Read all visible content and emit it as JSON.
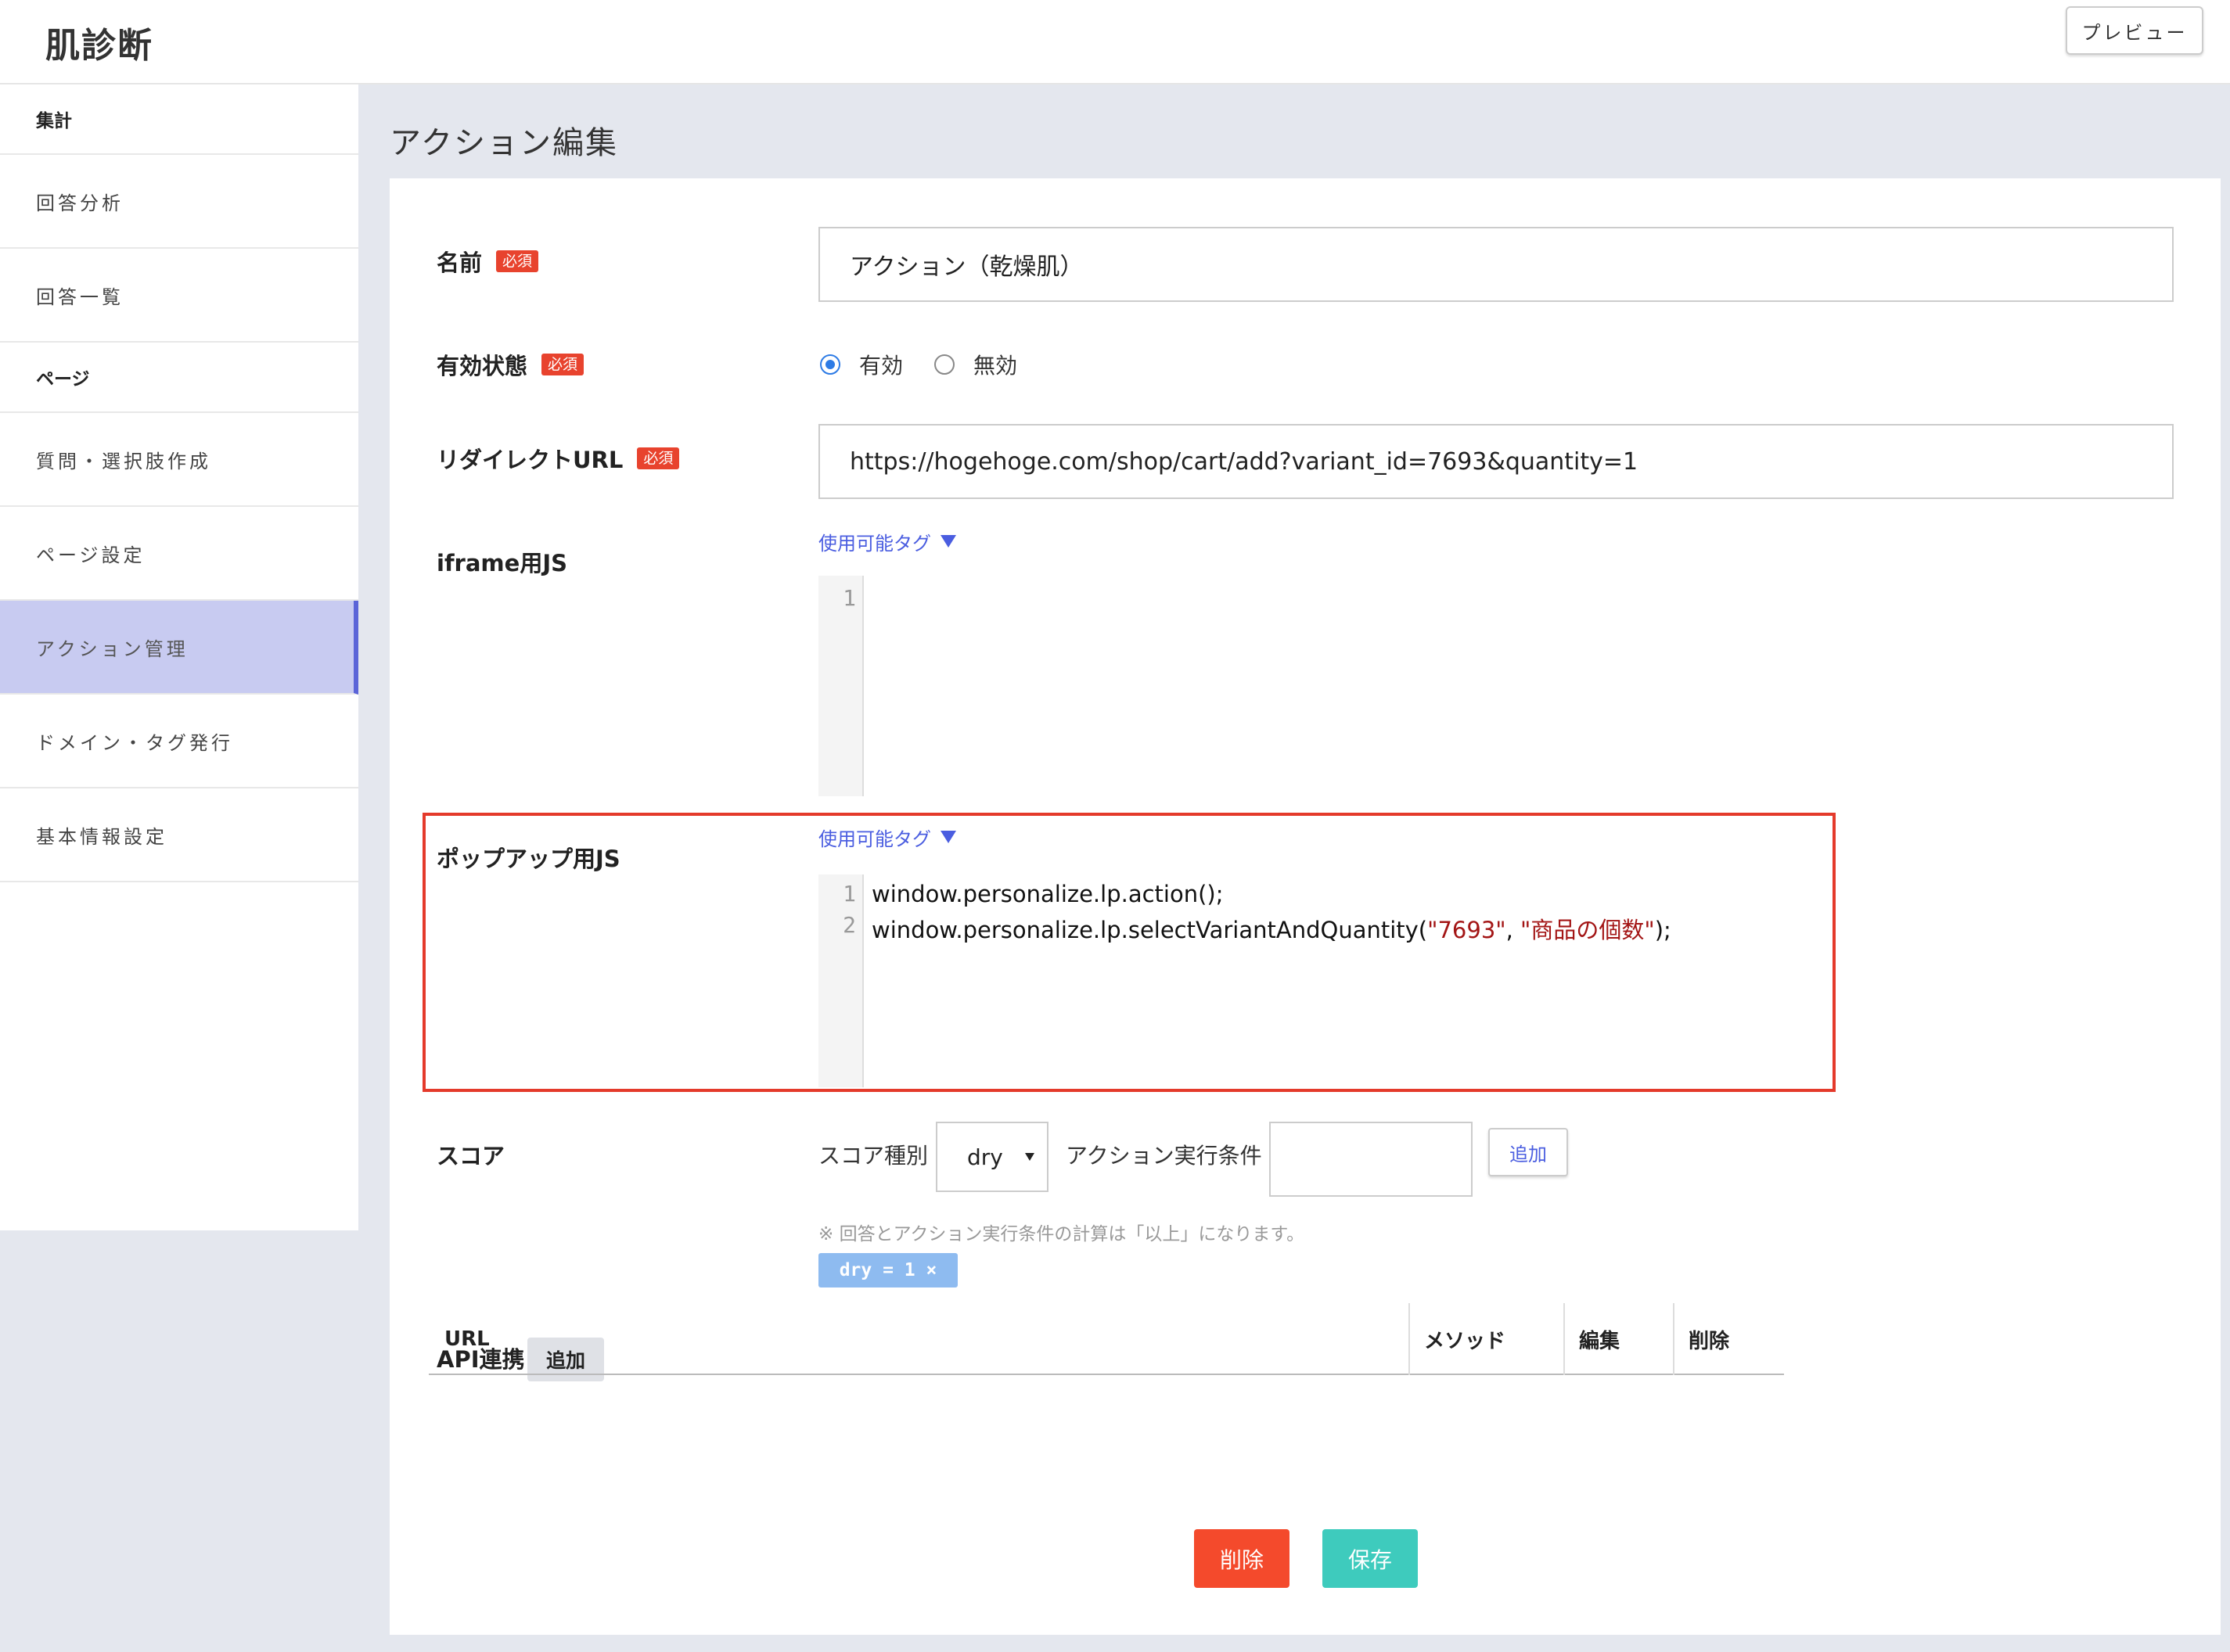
{
  "header": {
    "app_title": "肌診断",
    "preview_label": "プレビュー"
  },
  "sidebar": {
    "sections": [
      {
        "title": "集計",
        "items": [
          "回答分析",
          "回答一覧"
        ]
      },
      {
        "title": "ページ",
        "items": [
          "質問・選択肢作成",
          "ページ設定",
          "アクション管理",
          "ドメイン・タグ発行",
          "基本情報設定"
        ]
      }
    ],
    "active_item": "アクション管理"
  },
  "page_title": "アクション編集",
  "required_badge": "必須",
  "form": {
    "name": {
      "label": "名前",
      "value": "アクション（乾燥肌）"
    },
    "status": {
      "label": "有効状態",
      "options": [
        "有効",
        "無効"
      ],
      "selected": "有効"
    },
    "redirect": {
      "label": "リダイレクトURL",
      "value": "https://hogehoge.com/shop/cart/add?variant_id=7693&quantity=1"
    },
    "iframe_js": {
      "label": "iframe用JS",
      "tags_link": "使用可能タグ",
      "line_numbers": [
        "1"
      ]
    },
    "popup_js": {
      "label": "ポップアップ用JS",
      "tags_link": "使用可能タグ",
      "line_numbers": [
        "1",
        "2"
      ],
      "line1": "window.personalize.lp.action();",
      "line2_prefix": "window.personalize.lp.selectVariantAndQuantity(",
      "line2_arg1": "\"7693\"",
      "line2_sep": ", ",
      "line2_arg2": "\"商品の個数\"",
      "line2_suffix": ");"
    },
    "score": {
      "label": "スコア",
      "type_label": "スコア種別",
      "type_value": "dry",
      "condition_label": "アクション実行条件",
      "condition_value": "",
      "add_label": "追加",
      "note": "※ 回答とアクション実行条件の計算は「以上」になります。",
      "chip": "dry = 1  ×"
    },
    "api": {
      "label": "API連携",
      "add_label": "追加",
      "columns": [
        "URL",
        "メソッド",
        "編集",
        "削除"
      ]
    }
  },
  "actions": {
    "delete_label": "削除",
    "save_label": "保存"
  },
  "colors": {
    "required": "#e8432e",
    "accent": "#5b64d8",
    "link": "#4a5de0",
    "delete": "#f44a2c",
    "save": "#3ecbbd",
    "highlight": "#e43a2b",
    "chip": "#8ebbf0"
  }
}
